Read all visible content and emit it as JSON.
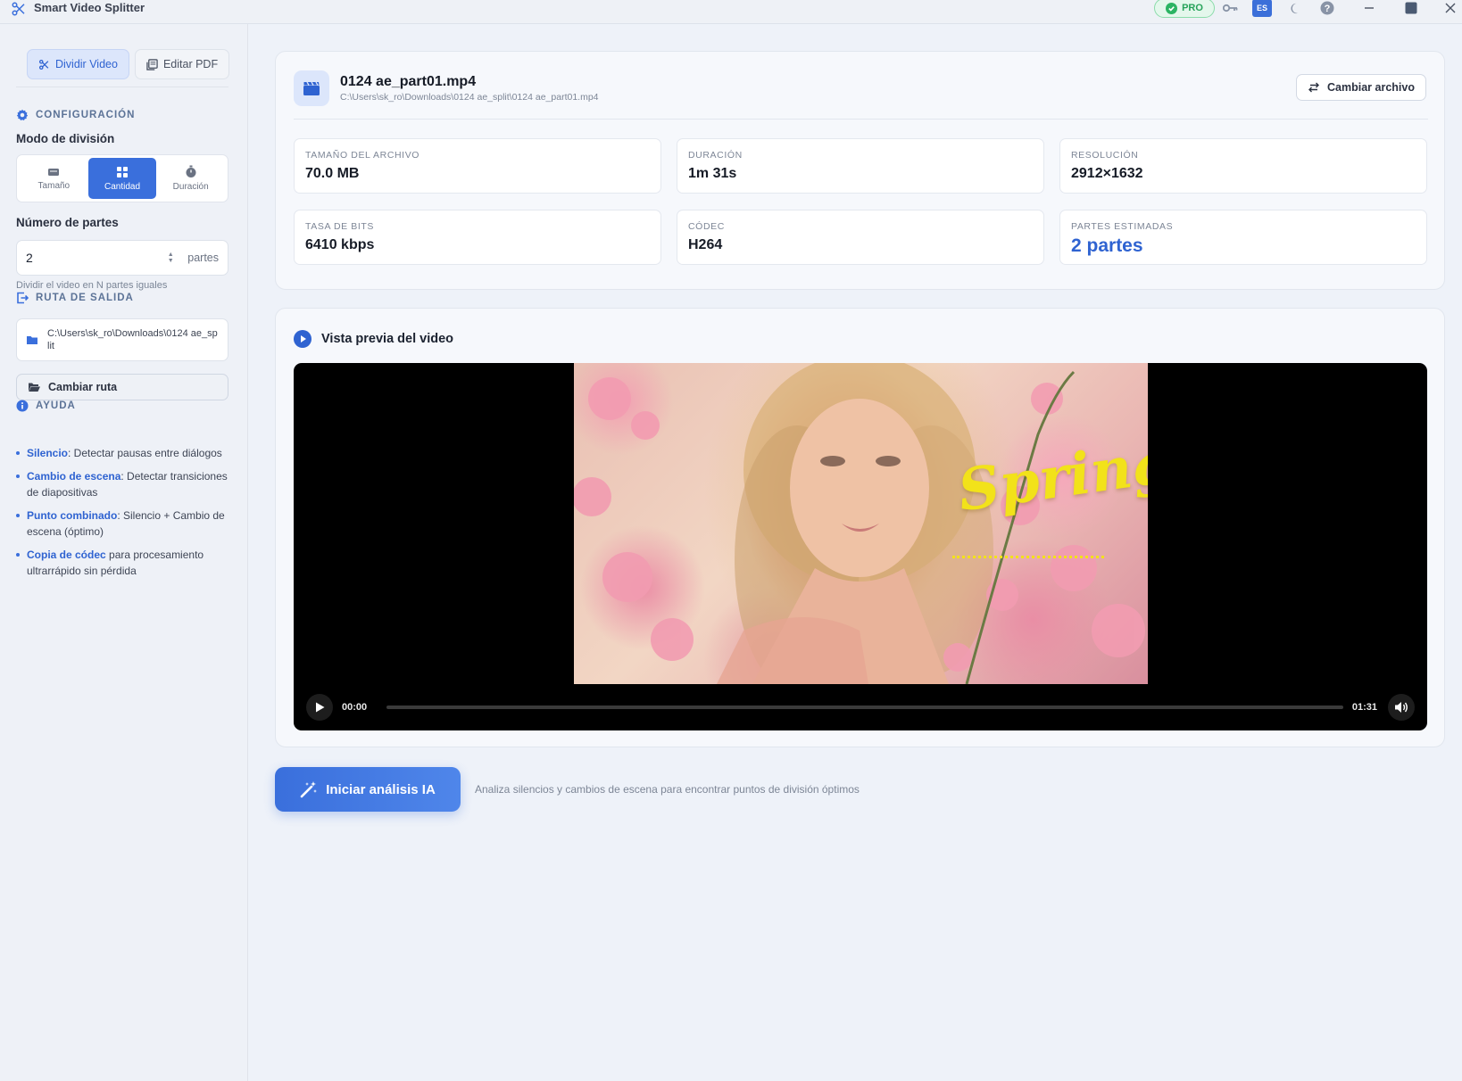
{
  "window": {
    "title": "Smart Video Splitter",
    "pro_label": "PRO",
    "lang": "ES"
  },
  "sidebar": {
    "tabs": [
      {
        "label": "Dividir Video",
        "icon": "scissors-icon",
        "active": true
      },
      {
        "label": "Editar PDF",
        "icon": "pdf-icon",
        "active": false
      }
    ],
    "config_heading": "CONFIGURACIÓN",
    "split_mode_label": "Modo de división",
    "split_modes": [
      {
        "label": "Tamaño",
        "icon": "drive-icon",
        "active": false
      },
      {
        "label": "Cantidad",
        "icon": "grid-icon",
        "active": true
      },
      {
        "label": "Duración",
        "icon": "stopwatch-icon",
        "active": false
      }
    ],
    "parts_label": "Número de partes",
    "parts_value": "2",
    "parts_unit": "partes",
    "parts_hint": "Dividir el video en N partes iguales",
    "output_heading": "RUTA DE SALIDA",
    "output_path": "C:\\Users\\sk_ro\\Downloads\\0124 ae_split",
    "change_route_label": "Cambiar ruta",
    "help_heading": "AYUDA",
    "help_items": [
      {
        "term": "Silencio",
        "text": ": Detectar pausas entre diálogos"
      },
      {
        "term": "Cambio de escena",
        "text": ": Detectar transiciones de diapositivas"
      },
      {
        "term": "Punto combinado",
        "text": ": Silencio + Cambio de escena (óptimo)"
      },
      {
        "term": "Copia de códec",
        "text": " para procesamiento ultrarrápido sin pérdida"
      }
    ]
  },
  "file": {
    "name": "0124 ae_part01.mp4",
    "path": "C:\\Users\\sk_ro\\Downloads\\0124 ae_split\\0124 ae_part01.mp4",
    "change_label": "Cambiar archivo",
    "stats": [
      {
        "label": "TAMAÑO DEL ARCHIVO",
        "value": "70.0 MB"
      },
      {
        "label": "DURACIÓN",
        "value": "1m 31s"
      },
      {
        "label": "RESOLUCIÓN",
        "value": "2912×1632"
      },
      {
        "label": "TASA DE BITS",
        "value": "6410 kbps"
      },
      {
        "label": "CÓDEC",
        "value": "H264"
      },
      {
        "label": "PARTES ESTIMADAS",
        "value": "2 partes"
      }
    ]
  },
  "preview": {
    "title": "Vista previa del video",
    "overlay_text": "Spring",
    "current_time": "00:00",
    "total_time": "01:31",
    "progress": 0
  },
  "action": {
    "analyze_label": "Iniciar análisis IA",
    "analyze_desc": "Analiza silencios y cambios de escena para encontrar puntos de división óptimos"
  },
  "colors": {
    "accent": "#3a6fdc",
    "pro_green": "#27a35a",
    "spring_yellow": "#f2e21a"
  }
}
